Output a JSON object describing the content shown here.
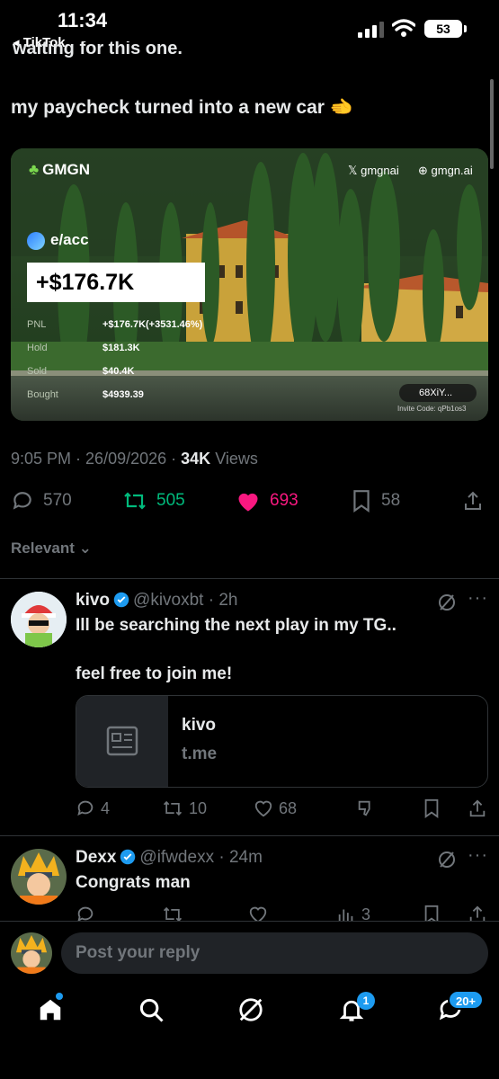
{
  "status": {
    "time": "11:34",
    "back_app": "◂ TikTok",
    "battery": "53"
  },
  "tweet": {
    "cut_text": "waiting for this one.",
    "text": "my paycheck turned into a new car 🫲",
    "media": {
      "brand": "GMGN",
      "x_handle": "𝕏 gmgnai",
      "site": "⊕ gmgn.ai",
      "account": "e/acc",
      "pnl_big": "+$176.7K",
      "stats": [
        {
          "label": "PNL",
          "value": "+$176.7K(+3531.46%)"
        },
        {
          "label": "Hold",
          "value": "$181.3K"
        },
        {
          "label": "Sold",
          "value": "$40.4K"
        },
        {
          "label": "Bought",
          "value": "$4939.39"
        }
      ],
      "badge": "68XiY...",
      "invite": "Invite Code: qPb1os3"
    },
    "time": "9:05 PM",
    "date": "26/09/2026",
    "views_count": "34K",
    "views_label": "Views",
    "replies": "570",
    "retweets": "505",
    "likes": "693",
    "bookmarks": "58",
    "colors": {
      "retweet": "#00ba7c",
      "like": "#f91880",
      "accent": "#1d9bf0"
    }
  },
  "sort_label": "Relevant",
  "replies": [
    {
      "name": "kivo",
      "handle": "@kivoxbt",
      "age": "2h",
      "body_line1": "Ill be searching the next play in my TG..",
      "body_line2": "feel free to join me!",
      "link_title": "kivo",
      "link_domain": "t.me",
      "replies": "4",
      "retweets": "10",
      "likes": "68"
    },
    {
      "name": "Dexx",
      "handle": "@ifwdexx",
      "age": "24m",
      "body_line1": "Congrats man",
      "views": "3"
    }
  ],
  "compose": {
    "placeholder": "Post your reply"
  },
  "tabbar": {
    "notifications_badge": "1",
    "messages_badge": "20+"
  }
}
